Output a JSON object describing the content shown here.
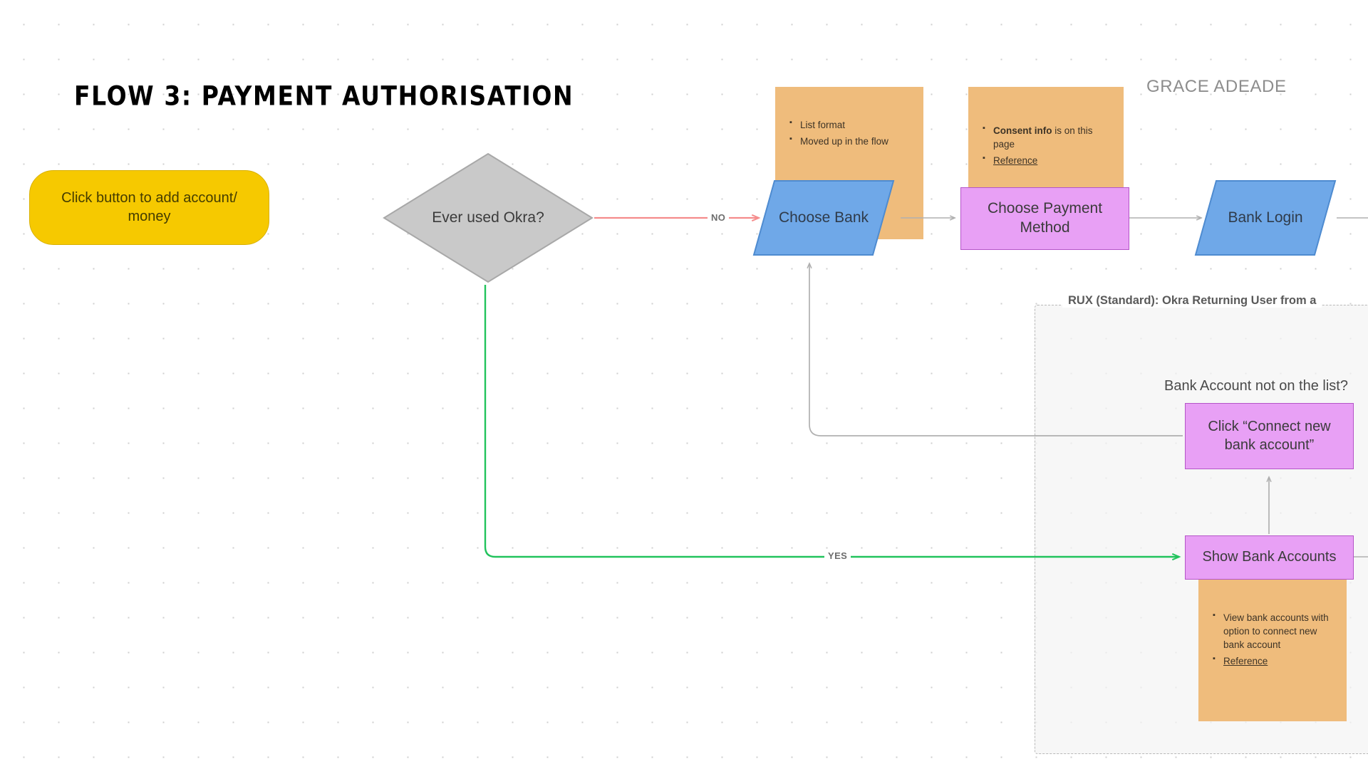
{
  "title": "FLOW 3: PAYMENT AUTHORISATION",
  "author": "GRACE ADEADE",
  "colors": {
    "start_fill": "#F6C900",
    "decision_fill": "#C9C9C9",
    "parallelogram_fill": "#6FA8E8",
    "process_fill": "#E8A0F5",
    "note_fill": "#EFBC7C",
    "edge_default": "#B0B0B0",
    "edge_no": "#F58C8C",
    "edge_yes": "#21C35C",
    "group_border": "#B8B8B8"
  },
  "nodes": {
    "add_account": "Click button to add account/ money",
    "decision": "Ever used Okra?",
    "choose_bank": "Choose Bank",
    "choose_payment": "Choose Payment Method",
    "bank_login": "Bank Login",
    "connect_new": "Click “Connect new bank account”",
    "show_accounts": "Show Bank Accounts"
  },
  "labels": {
    "no": "NO",
    "yes": "YES",
    "not_on_list": "Bank Account not on the list?"
  },
  "group": {
    "title": "RUX (Standard): Okra Returning User from a"
  },
  "notes": {
    "choose_bank": {
      "items": [
        {
          "text": "List format"
        },
        {
          "text": "Moved up in the flow"
        }
      ]
    },
    "consent": {
      "items": [
        {
          "bold": "Consent info",
          "text": " is on this page"
        },
        {
          "link": "Reference"
        }
      ]
    },
    "show_accounts": {
      "items": [
        {
          "text": "View bank accounts with option to connect new bank account"
        },
        {
          "link": "Reference"
        }
      ]
    }
  }
}
